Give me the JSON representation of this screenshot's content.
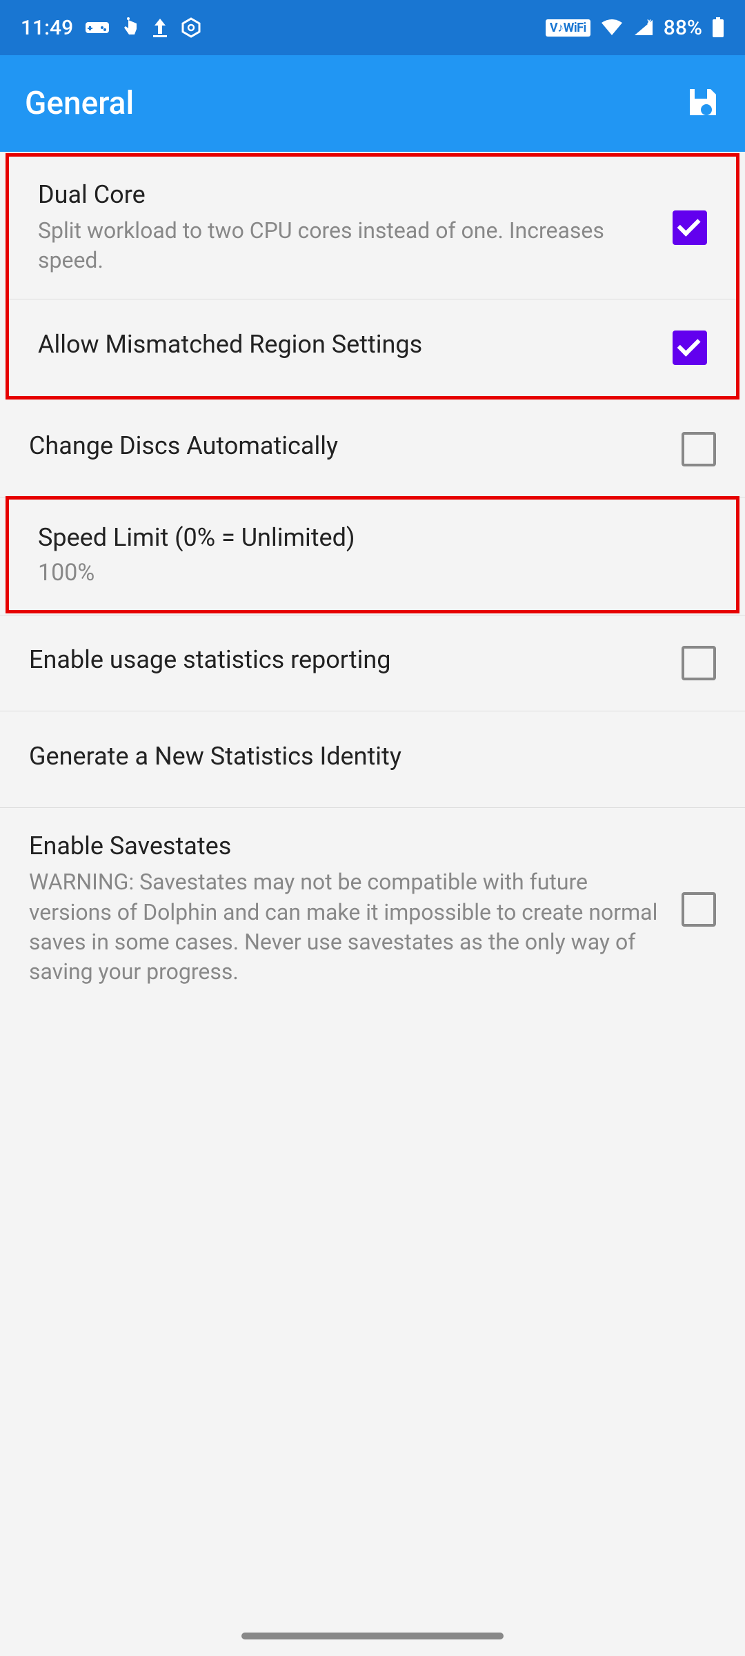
{
  "status": {
    "time": "11:49",
    "battery": "88%",
    "vowifi": "V♪WiFi"
  },
  "header": {
    "title": "General"
  },
  "settings": {
    "dual_core": {
      "title": "Dual Core",
      "desc": "Split workload to two CPU cores instead of one. Increases speed.",
      "checked": true
    },
    "mismatched_region": {
      "title": "Allow Mismatched Region Settings",
      "checked": true
    },
    "change_discs": {
      "title": "Change Discs Automatically",
      "checked": false
    },
    "speed_limit": {
      "title": "Speed Limit (0% = Unlimited)",
      "value": "100%"
    },
    "usage_stats": {
      "title": "Enable usage statistics reporting",
      "checked": false
    },
    "new_stats_id": {
      "title": "Generate a New Statistics Identity"
    },
    "savestates": {
      "title": "Enable Savestates",
      "desc": "WARNING: Savestates may not be compatible with future versions of Dolphin and can make it impossible to create normal saves in some cases. Never use savestates as the only way of saving your progress.",
      "checked": false
    }
  }
}
